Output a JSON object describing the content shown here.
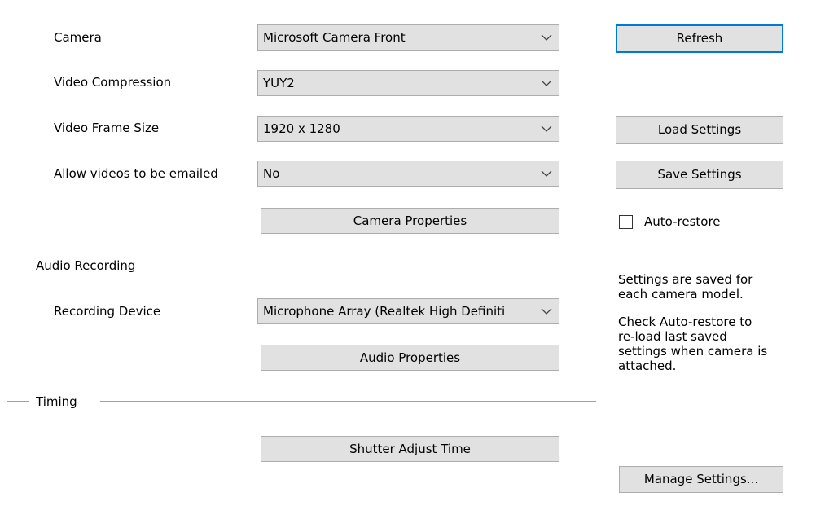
{
  "camera": {
    "label": "Camera",
    "value": "Microsoft Camera Front"
  },
  "video_compression": {
    "label": "Video Compression",
    "value": "YUY2"
  },
  "video_frame_size": {
    "label": "Video Frame Size",
    "value": "1920 x 1280"
  },
  "allow_email": {
    "label": "Allow videos to be emailed",
    "value": "No"
  },
  "camera_properties_label": "Camera Properties",
  "audio_section": {
    "title": "Audio Recording",
    "device_label": "Recording Device",
    "device_value": "Microphone Array (Realtek High Definiti",
    "properties_label": "Audio Properties"
  },
  "timing_section": {
    "title": "Timing",
    "shutter_label": "Shutter Adjust Time"
  },
  "right_panel": {
    "refresh_label": "Refresh",
    "load_label": "Load Settings",
    "save_label": "Save Settings",
    "auto_restore_label": "Auto-restore",
    "auto_restore_checked": false,
    "info_lines": [
      "Settings are saved for",
      "each camera model.",
      "",
      "Check Auto-restore to",
      "re-load last saved",
      "settings when camera is",
      "attached."
    ],
    "manage_label": "Manage Settings..."
  },
  "colors": {
    "button_face": "#e1e1e1",
    "button_border": "#adadad",
    "focus_border": "#0078d7",
    "separator": "#a0a0a0"
  },
  "icons": {
    "dropdown": "chevron-down-icon"
  }
}
